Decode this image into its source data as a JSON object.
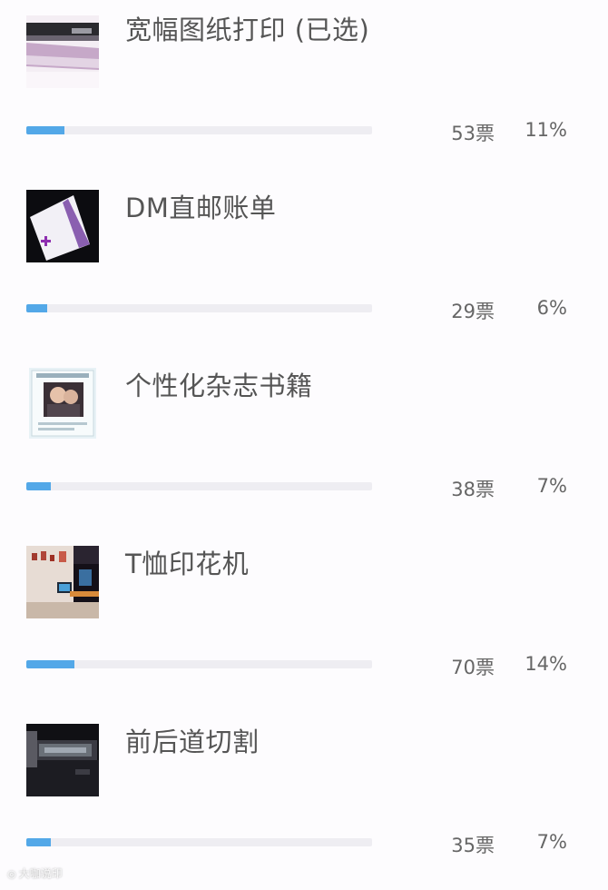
{
  "options": [
    {
      "title": "宽幅图纸打印 (已选)",
      "votes": "53票",
      "percent": "11%",
      "fraction": 0.11,
      "image": "wide-format-printer-photo"
    },
    {
      "title": "DM直邮账单",
      "votes": "29票",
      "percent": "6%",
      "fraction": 0.06,
      "image": "dm-mailer-photo"
    },
    {
      "title": "个性化杂志书籍",
      "votes": "38票",
      "percent": "7%",
      "fraction": 0.07,
      "image": "magazine-photo"
    },
    {
      "title": "T恤印花机",
      "votes": "70票",
      "percent": "14%",
      "fraction": 0.14,
      "image": "tshirt-printer-photo"
    },
    {
      "title": "前后道切割",
      "votes": "35票",
      "percent": "7%",
      "fraction": 0.07,
      "image": "cutting-machine-photo"
    }
  ],
  "colors": {
    "bar_fill": "#53a8e8",
    "bar_track": "#eeedf2",
    "text": "#555555"
  },
  "watermark": {
    "text": "大咖说印"
  }
}
